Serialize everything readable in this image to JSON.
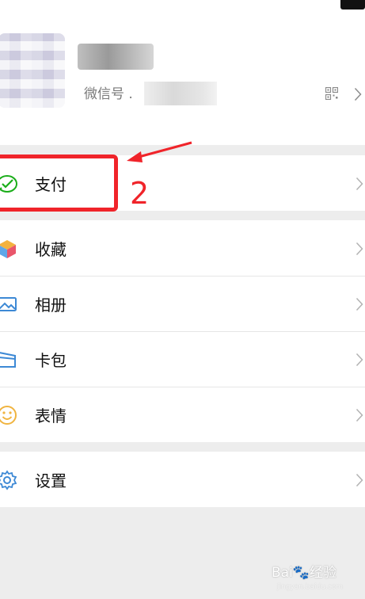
{
  "profile": {
    "wechat_id_label": "微信号 ."
  },
  "menu": {
    "pay": {
      "label": "支付",
      "icon": "wechat-pay-icon"
    },
    "favorites": {
      "label": "收藏",
      "icon": "favorites-cube-icon"
    },
    "album": {
      "label": "相册",
      "icon": "album-icon"
    },
    "cards": {
      "label": "卡包",
      "icon": "card-wallet-icon"
    },
    "stickers": {
      "label": "表情",
      "icon": "smiley-icon"
    },
    "settings": {
      "label": "设置",
      "icon": "gear-icon"
    }
  },
  "annotation": {
    "step_number": "2",
    "color": "#f0242a"
  },
  "watermark": {
    "text": "Bai🐾经验",
    "sub": "jingyan.baidu.com"
  }
}
